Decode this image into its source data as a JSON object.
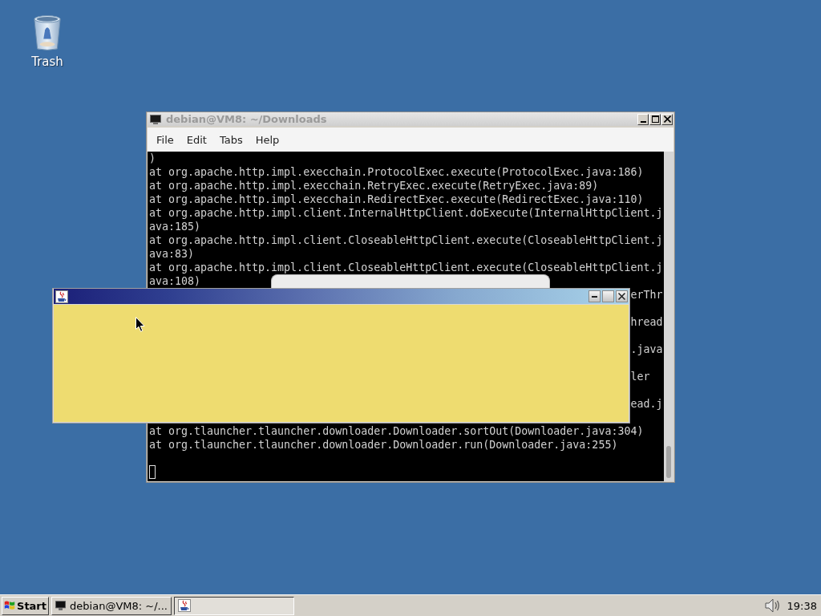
{
  "desktop": {
    "icons": [
      {
        "kind": "trash",
        "label": "Trash"
      }
    ]
  },
  "terminal_window": {
    "title": "debian@VM8: ~/Downloads",
    "active": false,
    "menu": [
      "File",
      "Edit",
      "Tabs",
      "Help"
    ],
    "lines_above": [
      ")",
      "at org.apache.http.impl.execchain.ProtocolExec.execute(ProtocolExec.java:186)",
      "at org.apache.http.impl.execchain.RetryExec.execute(RetryExec.java:89)",
      "at org.apache.http.impl.execchain.RedirectExec.execute(RedirectExec.java:110)",
      "at org.apache.http.impl.client.InternalHttpClient.doExecute(InternalHttpClient.j",
      "ava:185)",
      "at org.apache.http.impl.client.CloseableHttpClient.execute(CloseableHttpClient.j",
      "ava:83)",
      "at org.apache.http.impl.client.CloseableHttpClient.execute(CloseableHttpClient.j",
      "ava:108)"
    ],
    "fragments_beside_dialog": [
      "erThr",
      "hread",
      ".java",
      "ler",
      "ead.j"
    ],
    "lines_below": [
      "at org.tlauncher.tlauncher.downloader.Downloader.sortOut(Downloader.java:304)",
      "at org.tlauncher.tlauncher.downloader.Downloader.run(Downloader.java:255)"
    ],
    "cursor": true
  },
  "dialog_window": {
    "active": true
  },
  "taskbar": {
    "start": "Start",
    "tasks": [
      {
        "kind": "terminal",
        "label": "debian@VM8: ~/...",
        "selected": false
      },
      {
        "kind": "java",
        "selected": true
      }
    ],
    "clock": "19:38"
  }
}
